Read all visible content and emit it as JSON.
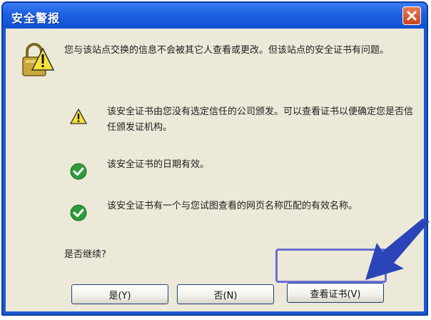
{
  "window": {
    "title": "安全警报"
  },
  "message": {
    "intro": "您与该站点交换的信息不会被其它人查看或更改。但该站点的安全证书有问题。"
  },
  "items": [
    {
      "icon": "warning-icon",
      "text": "该安全证书由您没有选定信任的公司颁发。可以查看证书以便确定您是否信任颁发证机构。"
    },
    {
      "icon": "check-icon",
      "text": "该安全证书的日期有效。"
    },
    {
      "icon": "check-icon",
      "text": "该安全证书有一个与您试图查看的网页名称匹配的有效名称。"
    }
  ],
  "prompt": "是否继续?",
  "buttons": {
    "yes": "是(Y)",
    "no": "否(N)",
    "view_cert": "查看证书(V)"
  },
  "colors": {
    "titlebar": "#1c5fe0",
    "client": "#ece9d8",
    "arrow": "#2b45b8",
    "highlight": "#6a6fd3"
  }
}
